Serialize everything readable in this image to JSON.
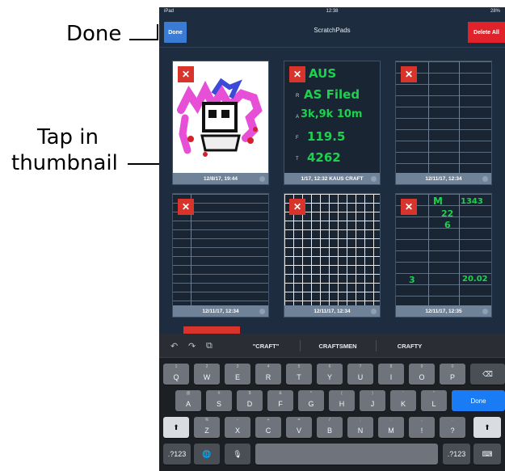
{
  "callouts": {
    "done": "Done",
    "tap_line1": "Tap in",
    "tap_line2": "thumbnail"
  },
  "status_bar": {
    "left": "iPad",
    "time": "12:38",
    "right": "28%"
  },
  "navbar": {
    "done_label": "Done",
    "title": "ScratchPads",
    "delete_all_label": "Delete All"
  },
  "thumbnails": [
    {
      "caption": "12/8/17, 19:44",
      "kind": "drawing"
    },
    {
      "caption": "1/17, 12:32 KAUS CRAFT",
      "kind": "craft",
      "lines": [
        "C",
        "R",
        "A",
        "F",
        "T"
      ],
      "values": [
        "AUS",
        "AS Filed",
        "3k,9k 10m",
        "119.5",
        "4262"
      ]
    },
    {
      "caption": "12/11/17, 12:34",
      "kind": "form"
    },
    {
      "caption": "12/11/17, 12:34",
      "kind": "form-lined"
    },
    {
      "caption": "12/11/17, 12:34",
      "kind": "grid"
    },
    {
      "caption": "12/11/17, 12:35",
      "kind": "form-hand",
      "hand": [
        "M",
        "1343",
        "22",
        "6",
        "3",
        "20.02"
      ]
    }
  ],
  "close_glyph": "✕",
  "keyboard": {
    "tools": [
      "↶",
      "↷",
      "⧉"
    ],
    "suggestions": [
      "\"CRAFT\"",
      "CRAFTSMEN",
      "CRAFTY"
    ],
    "row1": [
      {
        "ch": "Q",
        "num": "1"
      },
      {
        "ch": "W",
        "num": "2"
      },
      {
        "ch": "E",
        "num": "3"
      },
      {
        "ch": "R",
        "num": "4"
      },
      {
        "ch": "T",
        "num": "5"
      },
      {
        "ch": "Y",
        "num": "6"
      },
      {
        "ch": "U",
        "num": "7"
      },
      {
        "ch": "I",
        "num": "8"
      },
      {
        "ch": "O",
        "num": "9"
      },
      {
        "ch": "P",
        "num": "0"
      }
    ],
    "backspace": "⌫",
    "row2": [
      {
        "ch": "A",
        "num": "@"
      },
      {
        "ch": "S",
        "num": "#"
      },
      {
        "ch": "D",
        "num": "$"
      },
      {
        "ch": "F",
        "num": "&"
      },
      {
        "ch": "G",
        "num": "*"
      },
      {
        "ch": "H",
        "num": "("
      },
      {
        "ch": "J",
        "num": ")"
      },
      {
        "ch": "K",
        "num": "'"
      },
      {
        "ch": "L",
        "num": "\""
      }
    ],
    "done_key": "Done",
    "shift": "⬆",
    "row3": [
      {
        "ch": "Z",
        "num": "%"
      },
      {
        "ch": "X",
        "num": "-"
      },
      {
        "ch": "C",
        "num": "+"
      },
      {
        "ch": "V",
        "num": "="
      },
      {
        "ch": "B",
        "num": "/"
      },
      {
        "ch": "N",
        "num": ";"
      },
      {
        "ch": "M",
        "num": ":"
      },
      {
        "ch": "!",
        "num": ","
      },
      {
        "ch": "?",
        "num": "."
      }
    ],
    "numbers_key": ".?123",
    "globe": "🌐",
    "mic": "🎙",
    "hide_key": "⌨"
  }
}
